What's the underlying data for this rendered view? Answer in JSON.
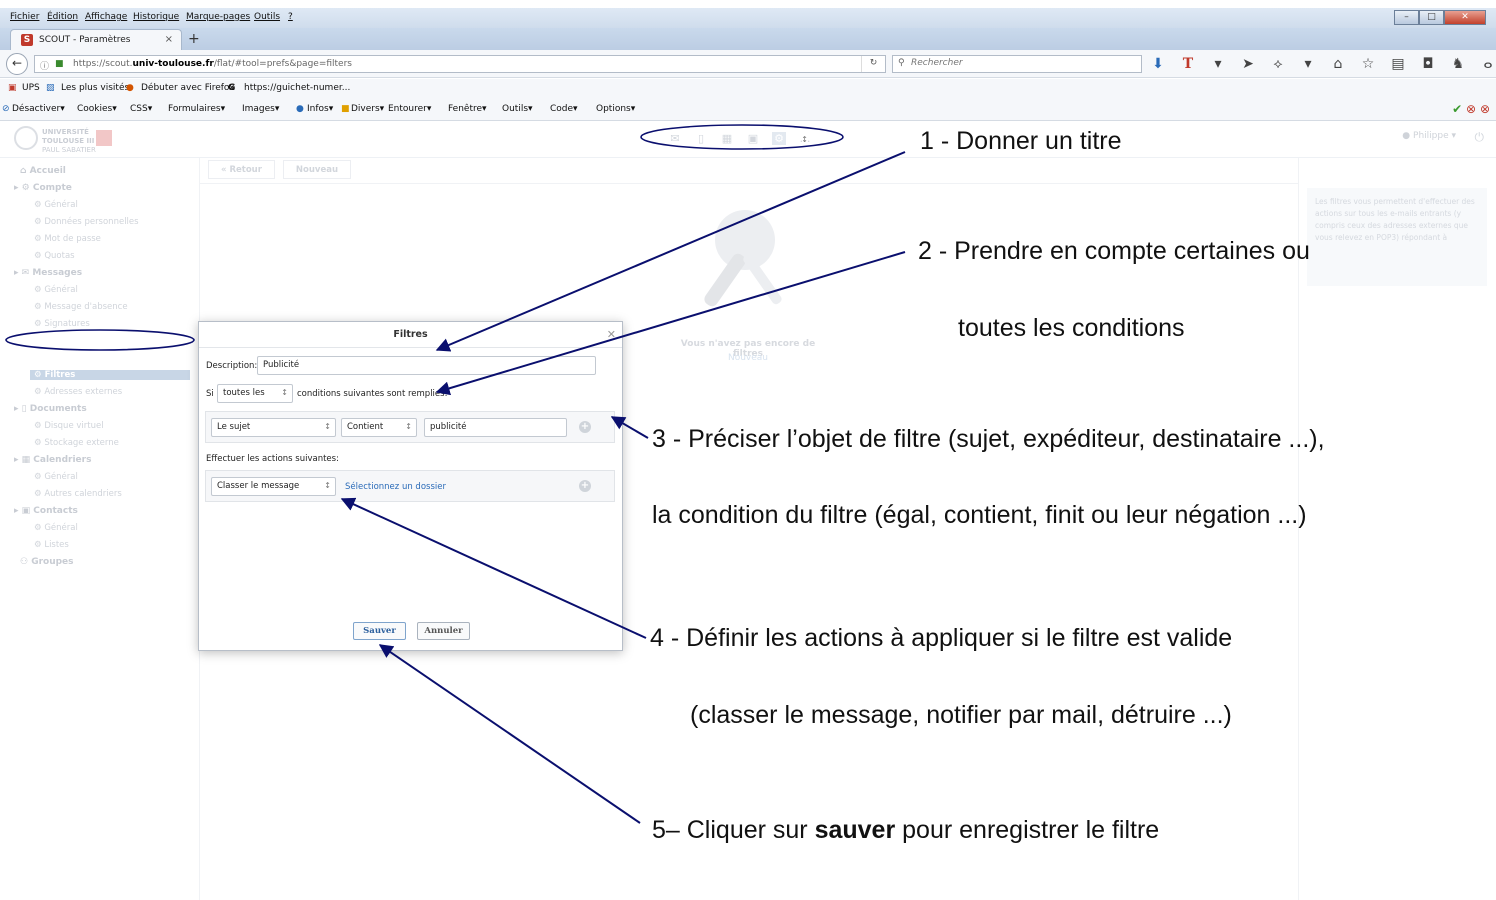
{
  "menubar": {
    "items": [
      "Fichier",
      "Édition",
      "Affichage",
      "Historique",
      "Marque-pages",
      "Outils",
      "?"
    ]
  },
  "tab": {
    "title": "SCOUT - Paramètres",
    "favicon": "S",
    "close": "×",
    "new": "+"
  },
  "nav": {
    "url_prefix": "https://scout.",
    "url_domain": "univ-toulouse.fr",
    "url_path": "/flat/#tool=prefs&page=filters",
    "search_placeholder": "Rechercher"
  },
  "bookmarks": [
    "UPS",
    "Les plus visités",
    "Débuter avec Firefox",
    "https://guichet-numer..."
  ],
  "webdev": [
    "Désactiver▾",
    "Cookies▾",
    "CSS▾",
    "Formulaires▾",
    "Images▾",
    "Infos▾",
    "Divers▾",
    "Entourer▾",
    "Fenêtre▾",
    "Outils▾",
    "Code▾",
    "Options▾"
  ],
  "app": {
    "logo": [
      "UNIVERSITÉ",
      "TOULOUSE III",
      "PAUL SABATIER"
    ],
    "user": "Philippe ▾",
    "back_button": "« Retour",
    "new_button": "Nouveau",
    "empty_text": "Vous n'avez pas encore de filtres",
    "empty_link": "Nouveau",
    "info_text": "Les filtres vous permettent d'effectuer des actions sur tous les e-mails entrants (y compris ceux des adresses externes que vous relevez en POP3) répondant à"
  },
  "sidebar": {
    "accueil": "Accueil",
    "compte": "Compte",
    "compte_items": [
      "Général",
      "Données personnelles",
      "Mot de passe",
      "Quotas"
    ],
    "messages": "Messages",
    "messages_items": [
      "Général",
      "Message d'absence",
      "Signatures",
      "Filtres",
      "Adresses externes"
    ],
    "documents": "Documents",
    "documents_items": [
      "Disque virtuel",
      "Stockage externe"
    ],
    "calendriers": "Calendriers",
    "calendriers_items": [
      "Général",
      "Autres calendriers"
    ],
    "contacts": "Contacts",
    "contacts_items": [
      "Général",
      "Listes"
    ],
    "groupes": "Groupes"
  },
  "dialog": {
    "title": "Filtres",
    "description_label": "Description:",
    "description_value": "Publicité",
    "si_label": "Si",
    "match_value": "toutes les",
    "match_suffix": "conditions suivantes sont remplies:",
    "cond_field": "Le sujet",
    "cond_op": "Contient",
    "cond_value": "publicité",
    "actions_label": "Effectuer les actions suivantes:",
    "action_value": "Classer le message",
    "action_link": "Sélectionnez un dossier",
    "save": "Sauver",
    "cancel": "Annuler"
  },
  "annotations": {
    "a1": "1 - Donner un titre",
    "a2_l1": "2 - Prendre en compte certaines ou",
    "a2_l2": "toutes les conditions",
    "a3_l1": "3 - Préciser l’objet de filtre (sujet, expéditeur, destinataire ...),",
    "a3_l2": "la condition du filtre (égal, contient, finit ou leur négation ...)",
    "a4_l1": "4 - Définir les actions à appliquer si le filtre est valide",
    "a4_l2": "(classer le message, notifier par mail, détruire ...)",
    "a5_pre": "5– Cliquer sur ",
    "a5_bold": "sauver",
    "a5_post": " pour enregistrer le filtre"
  },
  "colors": {
    "arrow": "#0a0f6e",
    "save_text": "#2a5e9c",
    "link": "#2a6bb8"
  }
}
